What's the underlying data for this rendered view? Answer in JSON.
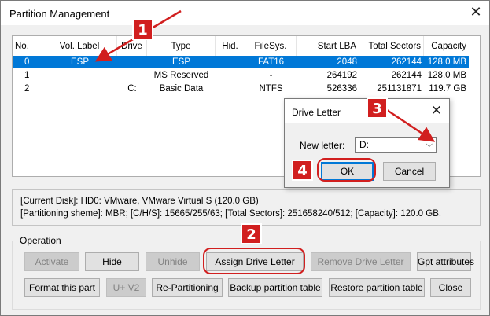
{
  "window": {
    "title": "Partition Management"
  },
  "table": {
    "headers": [
      "No.",
      "Vol. Label",
      "Drive",
      "Type",
      "Hid.",
      "FileSys.",
      "Start LBA",
      "Total Sectors",
      "Capacity"
    ],
    "rows": [
      [
        "0",
        "ESP",
        "",
        "ESP",
        "",
        "FAT16",
        "2048",
        "262144",
        "128.0 MB"
      ],
      [
        "1",
        "",
        "",
        "MS Reserved",
        "",
        "-",
        "264192",
        "262144",
        "128.0 MB"
      ],
      [
        "2",
        "",
        "C:",
        "Basic Data",
        "",
        "NTFS",
        "526336",
        "251131871",
        "119.7 GB"
      ]
    ],
    "selected_row": 0
  },
  "info": {
    "line1": "[Current Disk]:   HD0: VMware, VMware Virtual S (120.0 GB)",
    "line2": "[Partitioning sheme]:     MBR;     [C/H/S]: 15665/255/63; [Total Sectors]: 251658240/512; [Capacity]: 120.0 GB."
  },
  "operation": {
    "label": "Operation",
    "buttons_row1": {
      "activate": "Activate",
      "hide": "Hide",
      "unhide": "Unhide",
      "assign": "Assign Drive Letter",
      "remove": "Remove Drive Letter",
      "gpt": "Gpt attributes"
    },
    "buttons_row2": {
      "format": "Format this part",
      "uv2": "U+ V2",
      "repartition": "Re-Partitioning",
      "backup": "Backup partition table",
      "restore": "Restore partition table",
      "close": "Close"
    }
  },
  "dialog": {
    "title": "Drive Letter",
    "label": "New letter:",
    "selected": "D:",
    "ok": "OK",
    "cancel": "Cancel"
  },
  "annotations": {
    "step1": "1",
    "step2": "2",
    "step3": "3",
    "step4": "4",
    "color": "#d11f1f"
  }
}
